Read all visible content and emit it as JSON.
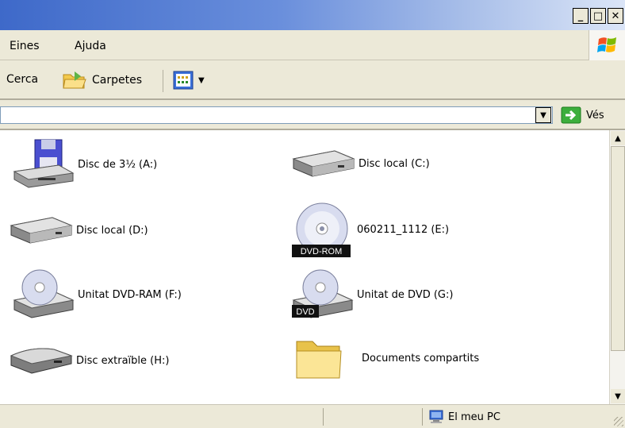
{
  "window": {
    "caption_buttons": [
      "_",
      "□",
      "✕"
    ]
  },
  "menu": {
    "items": [
      "Eines",
      "Ajuda"
    ]
  },
  "toolbar": {
    "search_label": "Cerca",
    "folders_label": "Carpetes",
    "views_icon": "views-icon"
  },
  "address": {
    "value": "",
    "go_label": "Vés"
  },
  "items": [
    {
      "label": "Disc de 3½ (A:)",
      "icon": "floppy-drive-icon"
    },
    {
      "label": "Disc local (C:)",
      "icon": "hard-disk-icon"
    },
    {
      "label": "Disc local (D:)",
      "icon": "hard-disk-icon"
    },
    {
      "label": "060211_1112 (E:)",
      "icon": "dvd-ram-disc-icon"
    },
    {
      "label": "Unitat DVD-RAM (F:)",
      "icon": "dvd-drive-icon"
    },
    {
      "label": "Unitat de DVD (G:)",
      "icon": "dvd-drive-icon"
    },
    {
      "label": "Disc extraïble (H:)",
      "icon": "removable-disk-icon"
    },
    {
      "label": "Documents compartits",
      "icon": "folder-icon"
    }
  ],
  "badges": {
    "dvd_ram": "DVD-ROM",
    "dvd": "DVD"
  },
  "status": {
    "location": "El meu PC"
  }
}
